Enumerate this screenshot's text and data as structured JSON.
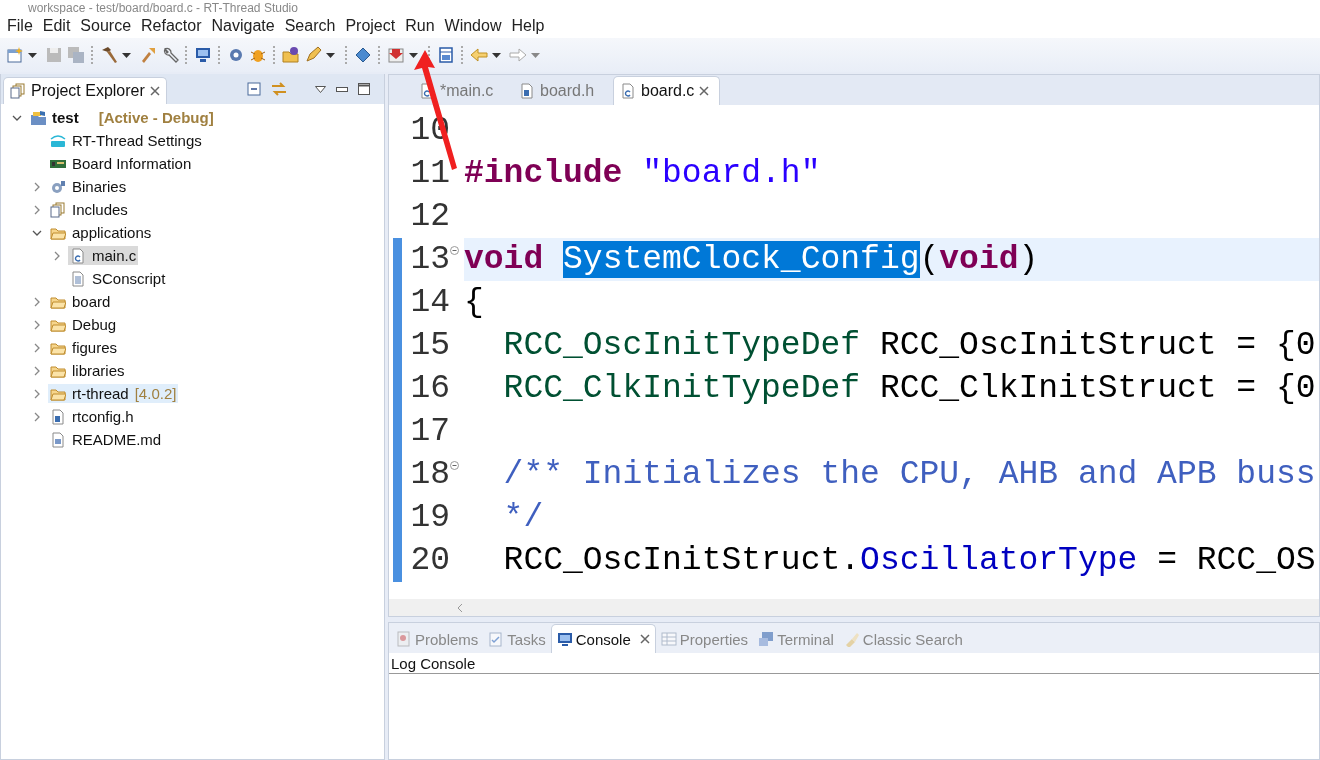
{
  "window": {
    "title": "workspace - test/board/board.c - RT-Thread Studio"
  },
  "menu": [
    {
      "label": "File"
    },
    {
      "label": "Edit"
    },
    {
      "label": "Source"
    },
    {
      "label": "Refactor"
    },
    {
      "label": "Navigate"
    },
    {
      "label": "Search"
    },
    {
      "label": "Project"
    },
    {
      "label": "Run"
    },
    {
      "label": "Window"
    },
    {
      "label": "Help"
    }
  ],
  "explorer": {
    "title": "Project Explorer",
    "tree": [
      {
        "label": "test",
        "decoration": "[Active - Debug]",
        "kind": "project",
        "expanded": true,
        "selected": false,
        "hovered": false,
        "children": [
          {
            "label": "RT-Thread Settings",
            "kind": "settings",
            "selected": false,
            "hovered": false
          },
          {
            "label": "Board Information",
            "kind": "board",
            "selected": false,
            "hovered": false
          },
          {
            "label": "Binaries",
            "kind": "binaries",
            "expanded": false,
            "selected": false,
            "hovered": false
          },
          {
            "label": "Includes",
            "kind": "includes",
            "expanded": false,
            "selected": false,
            "hovered": false
          },
          {
            "label": "applications",
            "kind": "folder",
            "expanded": true,
            "selected": false,
            "hovered": false,
            "children": [
              {
                "label": "main.c",
                "kind": "c-file",
                "expanded": false,
                "selected": true,
                "hovered": false
              },
              {
                "label": "SConscript",
                "kind": "text-file",
                "selected": false,
                "hovered": false
              }
            ]
          },
          {
            "label": "board",
            "kind": "folder",
            "expanded": false,
            "selected": false,
            "hovered": false
          },
          {
            "label": "Debug",
            "kind": "folder",
            "expanded": false,
            "selected": false,
            "hovered": false
          },
          {
            "label": "figures",
            "kind": "folder",
            "expanded": false,
            "selected": false,
            "hovered": false
          },
          {
            "label": "libraries",
            "kind": "folder",
            "expanded": false,
            "selected": false,
            "hovered": false
          },
          {
            "label": "rt-thread",
            "decoration": "[4.0.2]",
            "kind": "folder",
            "expanded": false,
            "selected": false,
            "hovered": true
          },
          {
            "label": "rtconfig.h",
            "kind": "h-file",
            "expanded": false,
            "selected": false,
            "hovered": false
          },
          {
            "label": "README.md",
            "kind": "doc-file",
            "selected": false,
            "hovered": false
          }
        ]
      }
    ]
  },
  "editor": {
    "tabs": [
      {
        "label": "*main.c",
        "kind": "c",
        "selected": false
      },
      {
        "label": "board.h",
        "kind": "h",
        "selected": false
      },
      {
        "label": "board.c",
        "kind": "c",
        "selected": true
      }
    ],
    "lines": [
      {
        "number": "10",
        "foldable": false,
        "current": false,
        "changed": false
      },
      {
        "number": "11",
        "foldable": false,
        "current": false,
        "changed": false,
        "tokens": [
          {
            "text": "#include",
            "kind": "keyword"
          },
          {
            "text": " \"board.h\"",
            "kind": "string"
          }
        ]
      },
      {
        "number": "12",
        "foldable": false,
        "current": false,
        "changed": false
      },
      {
        "number": "13",
        "foldable": true,
        "current": true,
        "changed": true,
        "tokens": [
          {
            "text": "void ",
            "kind": "keyword"
          },
          {
            "text": "SystemClock_Config",
            "kind": "selection"
          },
          {
            "text": "(",
            "kind": "plain"
          },
          {
            "text": "void",
            "kind": "keyword"
          },
          {
            "text": ")",
            "kind": "plain"
          }
        ]
      },
      {
        "number": "14",
        "foldable": false,
        "current": false,
        "changed": true,
        "tokens": [
          {
            "text": "{",
            "kind": "plain"
          }
        ]
      },
      {
        "number": "15",
        "foldable": false,
        "current": false,
        "changed": true,
        "tokens": [
          {
            "text": "  RCC_OscInitTypeDef",
            "kind": "type"
          },
          {
            "text": " RCC_OscInitStruct = {0",
            "kind": "plain"
          }
        ]
      },
      {
        "number": "16",
        "foldable": false,
        "current": false,
        "changed": true,
        "tokens": [
          {
            "text": "  RCC_ClkInitTypeDef",
            "kind": "type"
          },
          {
            "text": " RCC_ClkInitStruct = {0",
            "kind": "plain"
          }
        ]
      },
      {
        "number": "17",
        "foldable": false,
        "current": false,
        "changed": true
      },
      {
        "number": "18",
        "foldable": true,
        "current": false,
        "changed": true,
        "tokens": [
          {
            "text": "  /** Initializes the CPU, AHB and APB buss",
            "kind": "comment"
          }
        ]
      },
      {
        "number": "19",
        "foldable": false,
        "current": false,
        "changed": true,
        "tokens": [
          {
            "text": "  */",
            "kind": "comment"
          }
        ]
      },
      {
        "number": "20",
        "foldable": false,
        "current": false,
        "changed": true,
        "tokens": [
          {
            "text": "  RCC_OscInitStruct.",
            "kind": "plain"
          },
          {
            "text": "OscillatorType",
            "kind": "field"
          },
          {
            "text": " = RCC_OS",
            "kind": "plain"
          }
        ]
      }
    ]
  },
  "bottom_panel": {
    "tabs": [
      {
        "label": "Problems",
        "kind": "problems",
        "selected": false
      },
      {
        "label": "Tasks",
        "kind": "tasks",
        "selected": false
      },
      {
        "label": "Console",
        "kind": "console",
        "selected": true
      },
      {
        "label": "Properties",
        "kind": "properties",
        "selected": false
      },
      {
        "label": "Terminal",
        "kind": "terminal",
        "selected": false
      },
      {
        "label": "Classic Search",
        "kind": "search",
        "selected": false
      }
    ],
    "console_title": "Log Console"
  }
}
